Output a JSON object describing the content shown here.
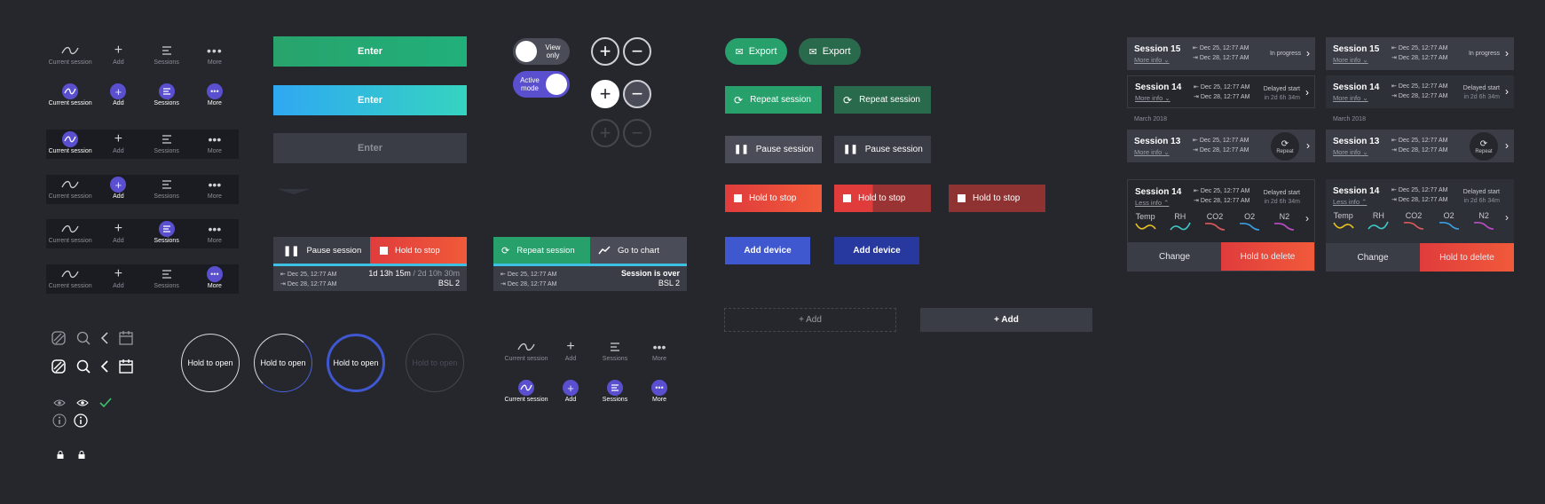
{
  "tabs": {
    "current_session": "Current session",
    "add": "Add",
    "sessions": "Sessions",
    "more": "More"
  },
  "enter_buttons": {
    "primary": "Enter",
    "secondary": "Enter",
    "disabled": "Enter"
  },
  "toggles": {
    "view_only": "View only",
    "active_mode": "Active mode"
  },
  "session_bar_left": {
    "pause": "Pause session",
    "hold_stop": "Hold to stop",
    "date_start": "Dec 25, 12:77 AM",
    "date_end": "Dec 28, 12:77 AM",
    "duration": "1d 13h 15m",
    "total": "/ 2d 10h 30m",
    "device": "BSL 2"
  },
  "session_bar_right": {
    "repeat": "Repeat session",
    "chart": "Go to chart",
    "date_start": "Dec 25, 12:77 AM",
    "date_end": "Dec 28, 12:77 AM",
    "status": "Session is over",
    "device": "BSL 2"
  },
  "hold_buttons": {
    "label": "Hold to open"
  },
  "export": {
    "label1": "Export",
    "label2": "Export"
  },
  "actions": {
    "repeat": "Repeat session",
    "pause": "Pause session",
    "hold_stop": "Hold to stop",
    "add_device": "Add device",
    "add_dashed": "+ Add",
    "add_solid": "+ Add"
  },
  "sessions_panel": {
    "month": "March 2018",
    "more_info": "More info",
    "less_info": "Less info",
    "repeat": "Repeat",
    "change": "Change",
    "hold_delete": "Hold to delete",
    "date_start": "Dec 25, 12:77 AM",
    "date_end": "Dec 28, 12:77 AM",
    "items": [
      {
        "name": "Session 15",
        "status": "In progress",
        "sub": ""
      },
      {
        "name": "Session 14",
        "status": "Delayed start",
        "sub": "in 2d 6h 34m"
      },
      {
        "name": "Session 13",
        "status": "",
        "sub": ""
      },
      {
        "name": "Session 14",
        "status": "Delayed start",
        "sub": "in 2d 6h 34m"
      }
    ],
    "metrics": [
      {
        "name": "Temp",
        "color": "#e8c020"
      },
      {
        "name": "RH",
        "color": "#3fc8c8"
      },
      {
        "name": "CO2",
        "color": "#e05a5a"
      },
      {
        "name": "O2",
        "color": "#3aa0e6"
      },
      {
        "name": "N2",
        "color": "#c04ec8"
      }
    ]
  }
}
